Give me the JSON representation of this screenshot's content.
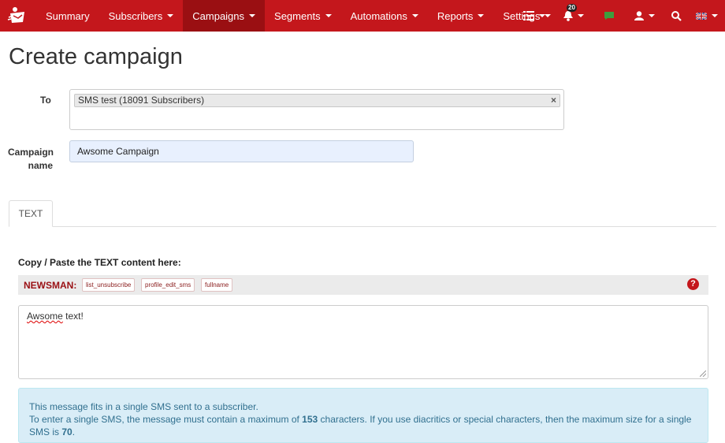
{
  "nav": {
    "items": [
      {
        "label": "Summary",
        "caret": false
      },
      {
        "label": "Subscribers",
        "caret": true
      },
      {
        "label": "Campaigns",
        "caret": true,
        "active": true
      },
      {
        "label": "Segments",
        "caret": true
      },
      {
        "label": "Automations",
        "caret": true
      },
      {
        "label": "Reports",
        "caret": true
      },
      {
        "label": "Settings",
        "caret": true
      }
    ],
    "notification_count": "20",
    "accent": "#c4171c",
    "active_bg": "#9a0f12"
  },
  "page": {
    "title": "Create campaign"
  },
  "form": {
    "to_label": "To",
    "to_token": "SMS test (18091 Subscribers)",
    "to_token_remove": "×",
    "name_label_1": "Campaign",
    "name_label_2": "name",
    "name_value": "Awsome Campaign"
  },
  "tabs": [
    {
      "label": "TEXT",
      "active": true
    }
  ],
  "editor": {
    "section_label": "Copy / Paste the TEXT content here:",
    "toolbar_title": "NEWSMAN:",
    "tags": [
      "list_unsubscribe",
      "profile_edit_sms",
      "fullname"
    ],
    "help": "?",
    "text_misspelled": "Awsome",
    "text_rest": " text!"
  },
  "info": {
    "line1": "This message fits in a single SMS sent to a subscriber.",
    "line2_a": "To enter a single SMS, the message must contain a maximum of ",
    "max_chars": "153",
    "line2_b": " characters. If you use diacritics or special characters, then the maximum size for a single SMS is",
    "max_special": "70",
    "line2_c": "."
  }
}
